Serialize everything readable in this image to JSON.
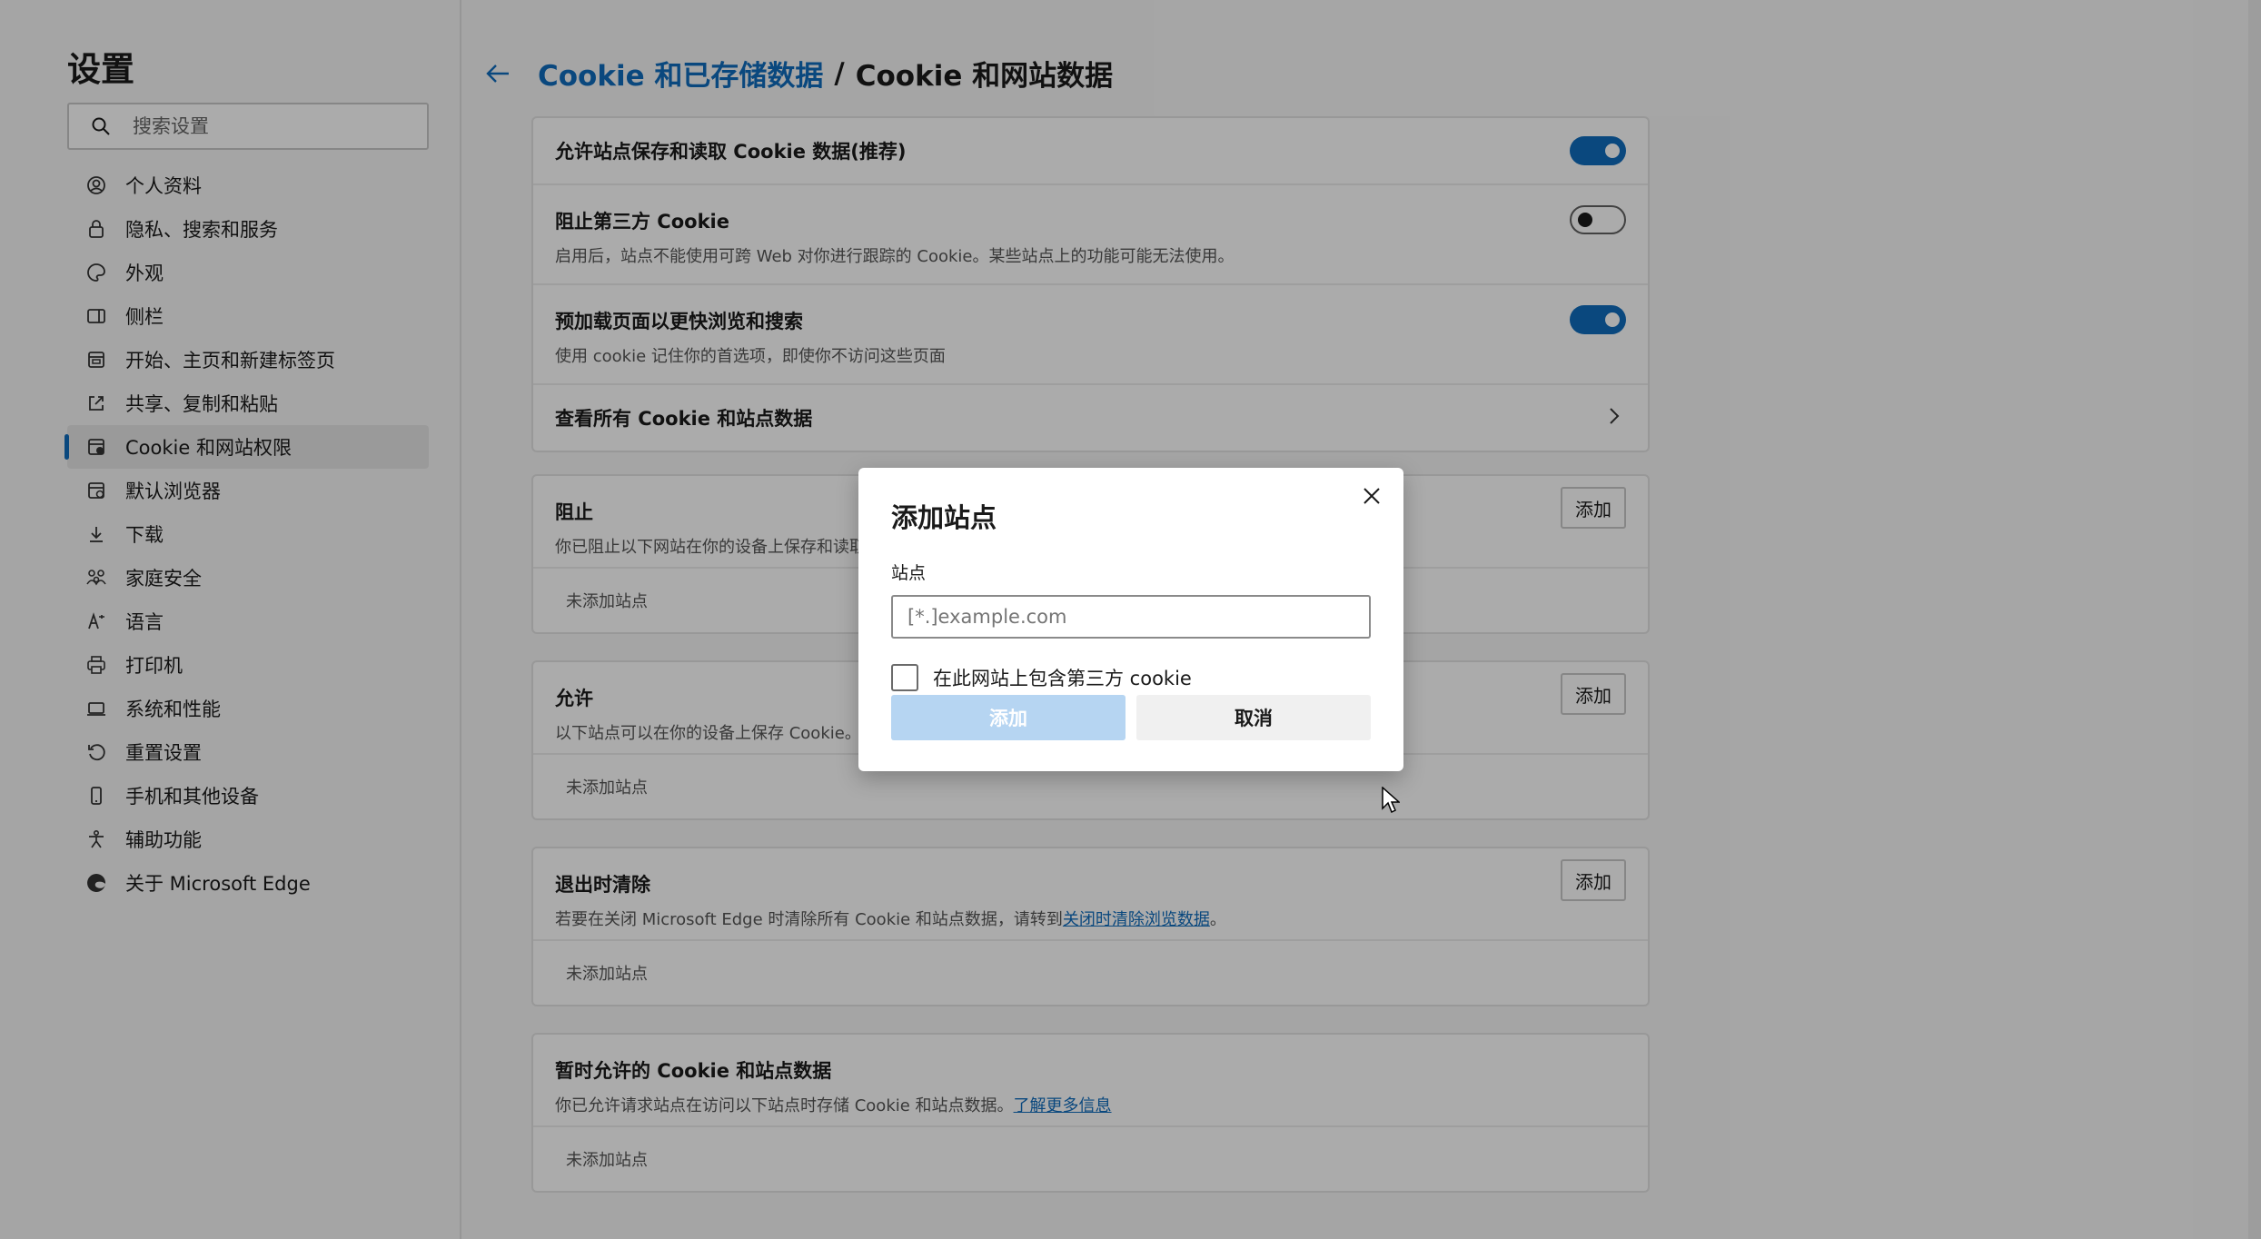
{
  "sidebar": {
    "title": "设置",
    "search_placeholder": "搜索设置",
    "items": [
      {
        "label": "个人资料",
        "icon": "profile-icon"
      },
      {
        "label": "隐私、搜索和服务",
        "icon": "lock-icon"
      },
      {
        "label": "外观",
        "icon": "palette-icon"
      },
      {
        "label": "侧栏",
        "icon": "sidebar-icon"
      },
      {
        "label": "开始、主页和新建标签页",
        "icon": "home-tab-icon"
      },
      {
        "label": "共享、复制和粘贴",
        "icon": "share-icon"
      },
      {
        "label": "Cookie 和网站权限",
        "icon": "cookie-permissions-icon",
        "active": true
      },
      {
        "label": "默认浏览器",
        "icon": "default-browser-icon"
      },
      {
        "label": "下载",
        "icon": "download-icon"
      },
      {
        "label": "家庭安全",
        "icon": "family-icon"
      },
      {
        "label": "语言",
        "icon": "language-icon"
      },
      {
        "label": "打印机",
        "icon": "printer-icon"
      },
      {
        "label": "系统和性能",
        "icon": "system-icon"
      },
      {
        "label": "重置设置",
        "icon": "reset-icon"
      },
      {
        "label": "手机和其他设备",
        "icon": "phone-icon"
      },
      {
        "label": "辅助功能",
        "icon": "accessibility-icon"
      },
      {
        "label": "关于 Microsoft Edge",
        "icon": "edge-icon"
      }
    ]
  },
  "header": {
    "back_icon": "back-arrow-icon",
    "crumb_link": "Cookie 和已存储数据",
    "separator": "/",
    "current": "Cookie 和网站数据"
  },
  "settings": {
    "allow_cookies": {
      "title": "允许站点保存和读取 Cookie 数据(推荐)",
      "on": true
    },
    "block_third_party": {
      "title": "阻止第三方 Cookie",
      "desc": "启用后，站点不能使用可跨 Web 对你进行跟踪的 Cookie。某些站点上的功能可能无法使用。",
      "on": false
    },
    "preload": {
      "title": "预加载页面以更快浏览和搜索",
      "desc": "使用 cookie 记住你的首选项，即使你不访问这些页面",
      "on": true
    },
    "see_all": {
      "title": "查看所有 Cookie 和站点数据"
    }
  },
  "sections": {
    "block": {
      "title": "阻止",
      "desc": "你已阻止以下网站在你的设备上保存和读取",
      "add": "添加",
      "empty": "未添加站点"
    },
    "allow": {
      "title": "允许",
      "desc": "以下站点可以在你的设备上保存 Cookie。",
      "add": "添加",
      "empty": "未添加站点"
    },
    "clear_on_exit": {
      "title": "退出时清除",
      "desc_prefix": "若要在关闭 Microsoft Edge 时清除所有 Cookie 和站点数据，请转到",
      "link": "关闭时清除浏览数据",
      "desc_suffix": "。",
      "add": "添加",
      "empty": "未添加站点"
    },
    "temp_allowed": {
      "title": "暂时允许的 Cookie 和站点数据",
      "desc_prefix": "你已允许请求站点在访问以下站点时存储 Cookie 和站点数据。",
      "link": "了解更多信息",
      "empty": "未添加站点"
    }
  },
  "dialog": {
    "title": "添加站点",
    "site_label": "站点",
    "site_placeholder": "[*.]example.com",
    "site_value": "",
    "checkbox_label": "在此网站上包含第三方 cookie",
    "checked": false,
    "add_button": "添加",
    "cancel_button": "取消",
    "close_icon": "close-icon"
  },
  "colors": {
    "accent": "#0f6cbd",
    "disabled_button": "#b6d5f2"
  }
}
